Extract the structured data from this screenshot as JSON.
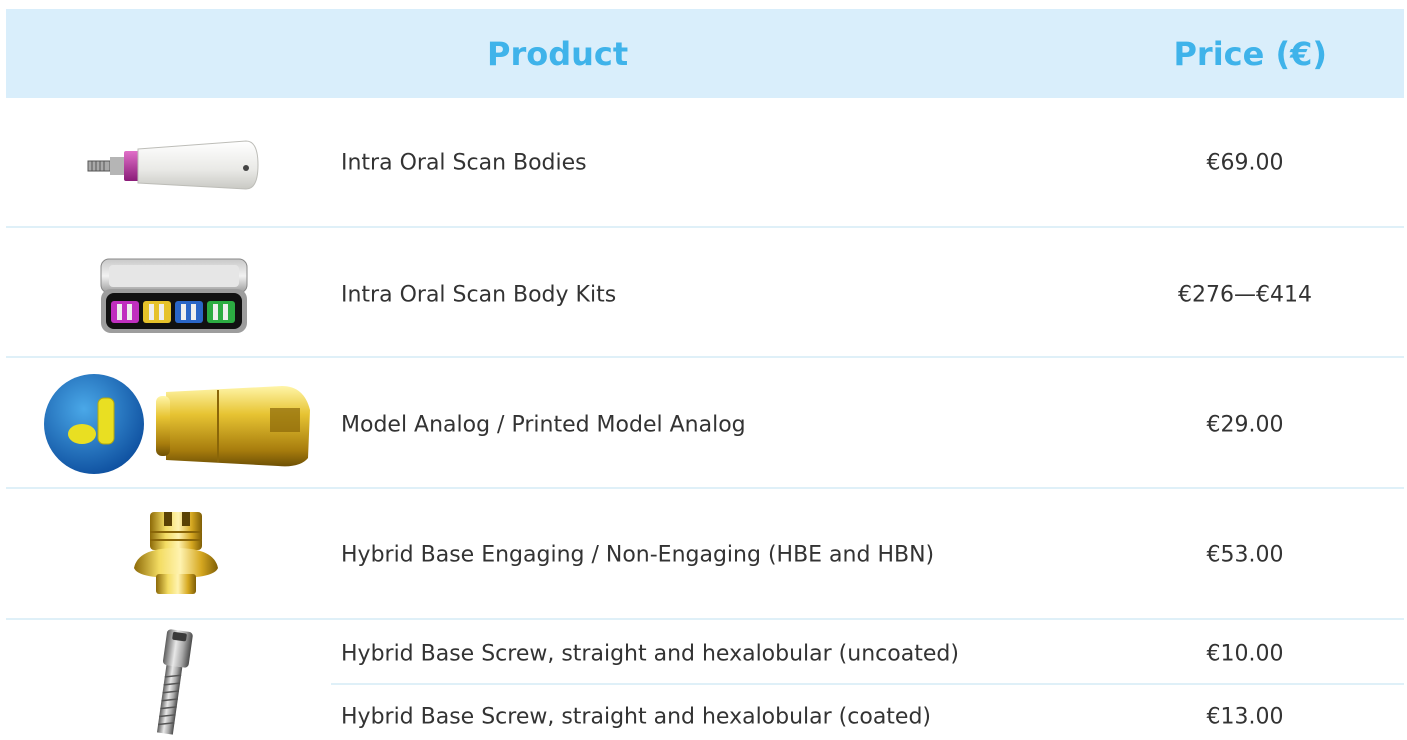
{
  "table": {
    "header": {
      "product": "Product",
      "price": "Price (€)"
    },
    "rows": [
      {
        "name": "Intra Oral Scan Bodies",
        "price": "€69.00",
        "icon": "scan-body-image"
      },
      {
        "name": "Intra Oral Scan Body Kits",
        "price": "€276—€414",
        "icon": "scan-body-kit-image"
      },
      {
        "name": "Model Analog / Printed Model Analog",
        "price": "€29.00",
        "icon": "model-analog-image"
      },
      {
        "name": "Hybrid Base Engaging / Non-Engaging (HBE and HBN)",
        "price": "€53.00",
        "icon": "hybrid-base-image"
      },
      {
        "name": "Hybrid Base Screw, straight and hexalobular (uncoated)",
        "price": "€10.00",
        "icon": "hybrid-base-screw-image"
      },
      {
        "name": "Hybrid Base Screw, straight and hexalobular (coated)",
        "price": "€13.00"
      }
    ]
  },
  "colors": {
    "header_bg": "#d9eefb",
    "header_text": "#3fb3ea",
    "divider": "#dff0f8"
  }
}
